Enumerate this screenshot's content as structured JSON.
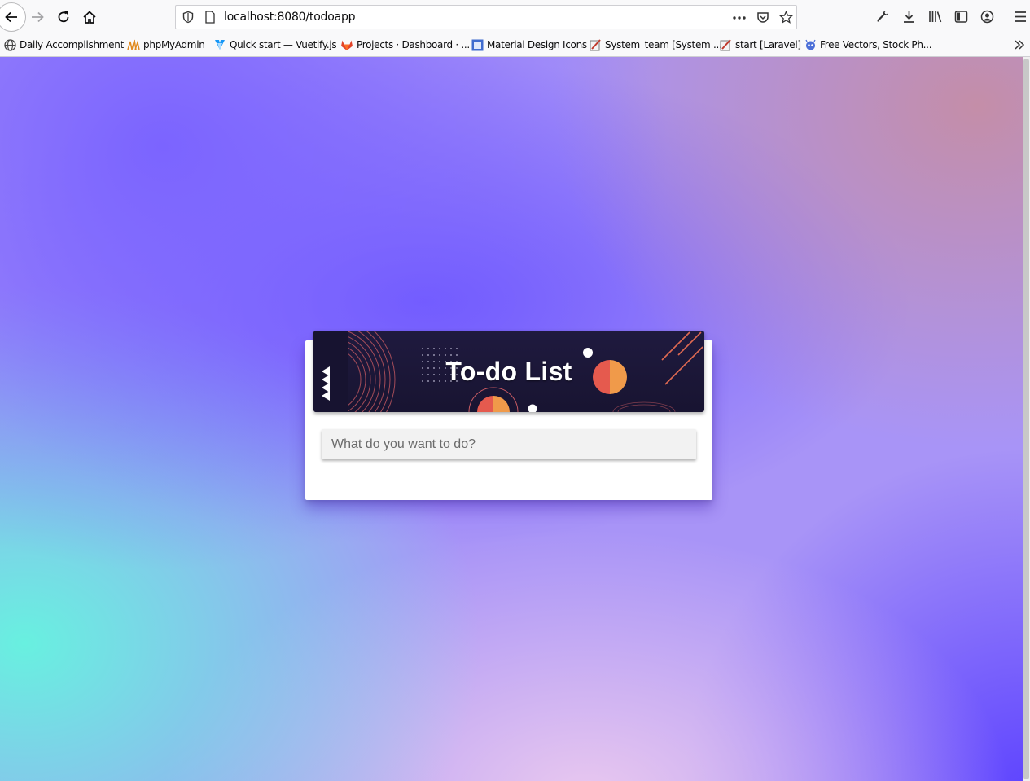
{
  "browser": {
    "url": "localhost:8080/todoapp",
    "bookmarks": [
      {
        "label": "Daily Accomplishment",
        "icon": "globe-icon"
      },
      {
        "label": "phpMyAdmin",
        "icon": "phpmyadmin-icon"
      },
      {
        "label": "Quick start — Vuetify.js",
        "icon": "vuetify-icon"
      },
      {
        "label": "Projects · Dashboard · ...",
        "icon": "gitlab-icon"
      },
      {
        "label": "Material Design Icons",
        "icon": "material-icons-icon"
      },
      {
        "label": "System_team [System ...",
        "icon": "wiki-icon"
      },
      {
        "label": "start [Laravel]",
        "icon": "wiki-icon"
      },
      {
        "label": "Free Vectors, Stock Ph...",
        "icon": "freepik-icon"
      }
    ]
  },
  "app": {
    "title": "To-do List",
    "input_placeholder": "What do you want to do?"
  },
  "colors": {
    "banner_background": "#1c1839",
    "accent_orange": "#f09a4a",
    "accent_red": "#e55a4e"
  }
}
